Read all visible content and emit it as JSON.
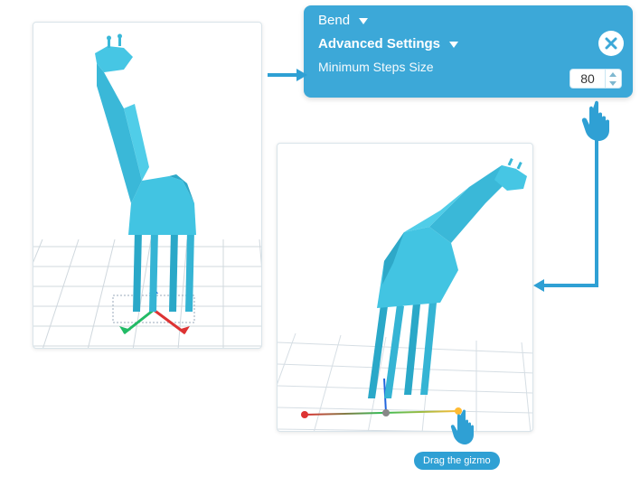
{
  "panel": {
    "title": "Bend",
    "section": "Advanced Settings",
    "label": "Minimum Steps Size",
    "value": "80"
  },
  "tooltip": {
    "gizmo": "Drag the gizmo"
  },
  "colors": {
    "panel": "#3ca8d8",
    "accent": "#2fa0d4",
    "model": "#3fc2e0"
  }
}
